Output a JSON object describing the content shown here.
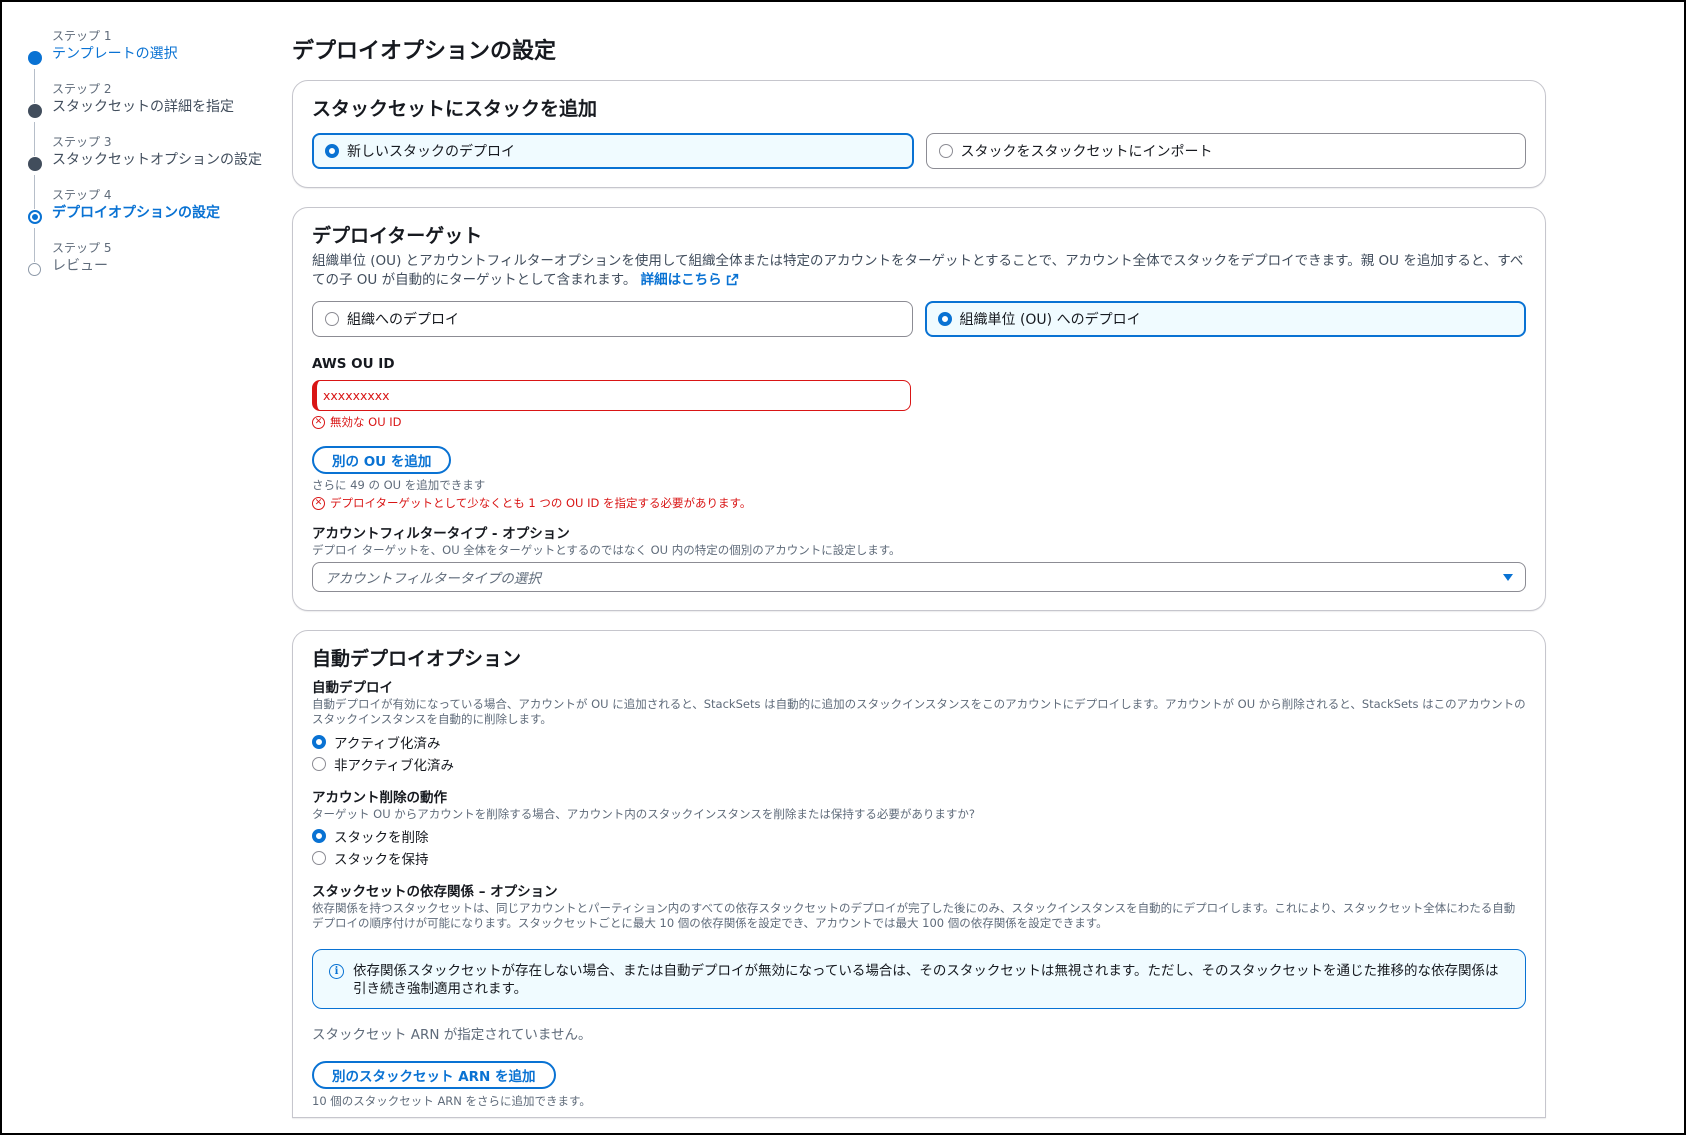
{
  "steps": [
    {
      "num": "ステップ 1",
      "label": "テンプレートの選択",
      "state": "done"
    },
    {
      "num": "ステップ 2",
      "label": "スタックセットの詳細を指定",
      "state": "visited"
    },
    {
      "num": "ステップ 3",
      "label": "スタックセットオプションの設定",
      "state": "visited"
    },
    {
      "num": "ステップ 4",
      "label": "デプロイオプションの設定",
      "state": "current"
    },
    {
      "num": "ステップ 5",
      "label": "レビュー",
      "state": "pending"
    }
  ],
  "page_title": "デプロイオプションの設定",
  "add_stacks": {
    "title": "スタックセットにスタックを追加",
    "options": [
      "新しいスタックのデプロイ",
      "スタックをスタックセットにインポート"
    ],
    "selected": 0
  },
  "deploy_target": {
    "title": "デプロイターゲット",
    "description": "組織単位 (OU) とアカウントフィルターオプションを使用して組織全体または特定のアカウントをターゲットとすることで、アカウント全体でスタックをデプロイできます。親 OU を追加すると、すべての子 OU が自動的にターゲットとして含まれます。",
    "learn_more": "詳細はこちら",
    "options": [
      "組織へのデプロイ",
      "組織単位 (OU) へのデプロイ"
    ],
    "selected": 1,
    "ou_label": "AWS OU ID",
    "ou_value": "xxxxxxxxx",
    "ou_error": "無効な OU ID",
    "add_ou_button": "別の OU を追加",
    "add_ou_hint": "さらに 49 の OU を追加できます",
    "target_error": "デプロイターゲットとして少なくとも 1 つの OU ID を指定する必要があります。",
    "filter_label": "アカウントフィルタータイプ - オプション",
    "filter_desc": "デプロイ ターゲットを、OU 全体をターゲットとするのではなく OU 内の特定の個別のアカウントに設定します。",
    "filter_placeholder": "アカウントフィルタータイプの選択"
  },
  "auto_deploy": {
    "title": "自動デプロイオプション",
    "auto_label": "自動デプロイ",
    "auto_desc": "自動デプロイが有効になっている場合、アカウントが OU に追加されると、StackSets は自動的に追加のスタックインスタンスをこのアカウントにデプロイします。アカウントが OU から削除されると、StackSets はこのアカウントのスタックインスタンスを自動的に削除します。",
    "auto_options": [
      "アクティブ化済み",
      "非アクティブ化済み"
    ],
    "auto_selected": 0,
    "removal_label": "アカウント削除の動作",
    "removal_desc": "ターゲット OU からアカウントを削除する場合、アカウント内のスタックインスタンスを削除または保持する必要がありますか?",
    "removal_options": [
      "スタックを削除",
      "スタックを保持"
    ],
    "removal_selected": 0,
    "deps_label": "スタックセットの依存関係 – オプション",
    "deps_desc": "依存関係を持つスタックセットは、同じアカウントとパーティション内のすべての依存スタックセットのデプロイが完了した後にのみ、スタックインスタンスを自動的にデプロイします。これにより、スタックセット全体にわたる自動デプロイの順序付けが可能になります。スタックセットごとに最大 10 個の依存関係を設定でき、アカウントでは最大 100 個の依存関係を設定できます。",
    "info_text": "依存関係スタックセットが存在しない場合、または自動デプロイが無効になっている場合は、そのスタックセットは無視されます。ただし、そのスタックセットを通じた推移的な依存関係は引き続き強制適用されます。",
    "no_arn": "スタックセット ARN が指定されていません。",
    "add_arn_button": "別のスタックセット ARN を追加",
    "add_arn_hint": "10 個のスタックセット ARN をさらに追加できます。"
  },
  "colors": {
    "accent": "#0972d3",
    "error": "#d91515",
    "info_bg": "#f0fbff"
  }
}
